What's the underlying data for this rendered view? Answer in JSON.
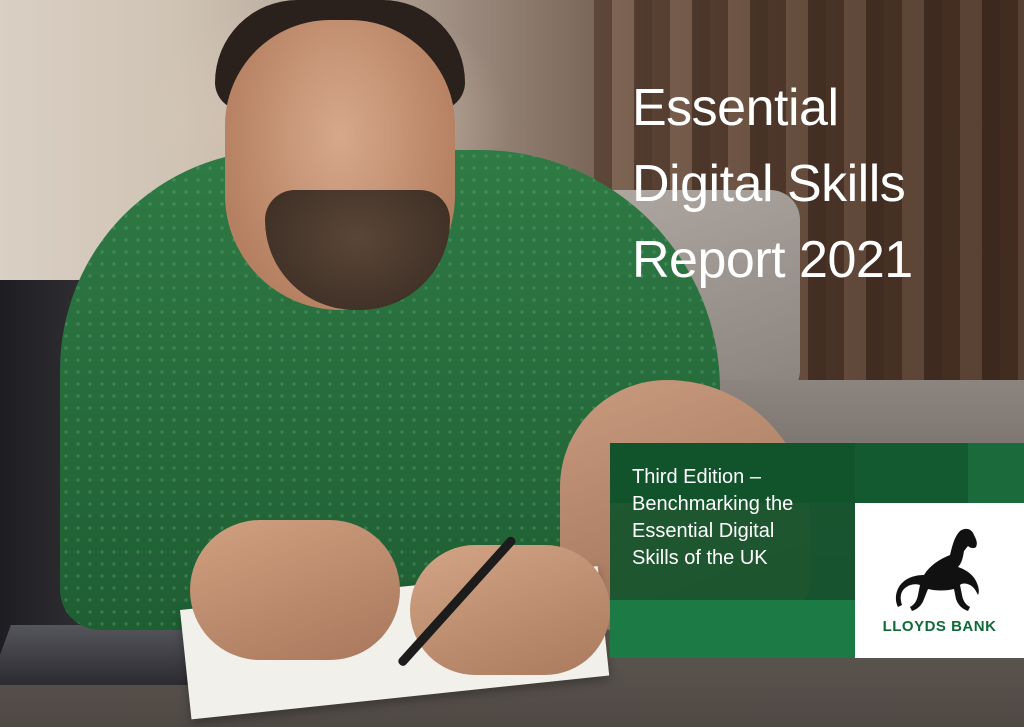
{
  "cover": {
    "title_lines": [
      "Essential",
      "Digital Skills",
      "Report 2021"
    ],
    "subtitle_lines": [
      "Third Edition –",
      "Benchmarking the",
      "Essential Digital",
      "Skills of the UK"
    ],
    "logo_text": "LLOYDS BANK",
    "logo_icon": "black-horse-icon",
    "colors": {
      "brand_green": "#11522b",
      "brand_green_light": "#1c7a44",
      "title_text": "#ffffff",
      "logo_text": "#0e6b36"
    }
  }
}
